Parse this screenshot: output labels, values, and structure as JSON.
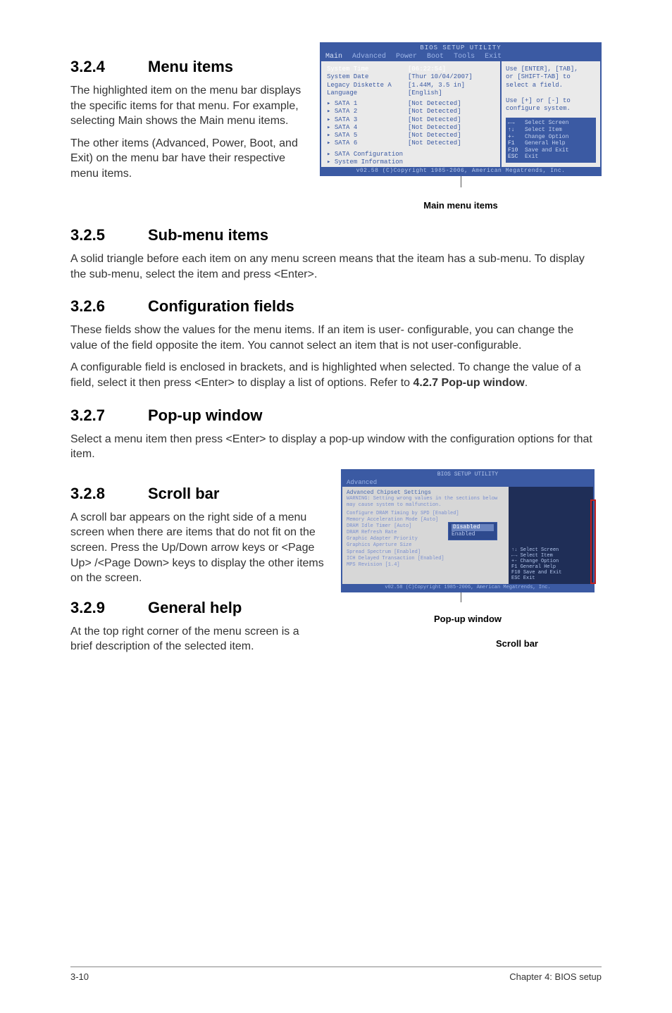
{
  "sections": {
    "s324": {
      "num": "3.2.4",
      "title": "Menu items",
      "p1": "The highlighted item on the menu bar displays the specific items for that menu. For example, selecting Main shows the Main menu items.",
      "p2": "The other items (Advanced, Power, Boot, and Exit) on the menu bar have their respective menu items."
    },
    "s325": {
      "num": "3.2.5",
      "title": "Sub-menu items",
      "p1": "A solid triangle before each item on any menu screen means that the iteam has a sub-menu. To display the sub-menu, select the item and press <Enter>."
    },
    "s326": {
      "num": "3.2.6",
      "title": "Configuration fields",
      "p1": "These fields show the values for the menu items. If an item is user- configurable, you can change the value of the field opposite the item. You cannot select an item that is not user-configurable.",
      "p2": "A configurable field is enclosed in brackets, and is highlighted when selected. To change the value of a field, select it then press <Enter> to display a list of options. Refer to ",
      "p2b": "4.2.7 Pop-up window",
      "p2c": "."
    },
    "s327": {
      "num": "3.2.7",
      "title": "Pop-up window",
      "p1": "Select a menu item then press <Enter> to display a pop-up window with the configuration options for that item."
    },
    "s328": {
      "num": "3.2.8",
      "title": "Scroll bar",
      "p1": "A scroll bar appears on the right side of a menu screen when there are items that do not fit on the screen. Press the Up/Down arrow keys or <Page Up> /<Page Down> keys to display the other items on the screen."
    },
    "s329": {
      "num": "3.2.9",
      "title": "General help",
      "p1": "At the top right corner of the menu screen is a brief description of the selected item."
    }
  },
  "bios1": {
    "title": "BIOS SETUP UTILITY",
    "menubar": [
      "Main",
      "Advanced",
      "Power",
      "Boot",
      "Tools",
      "Exit"
    ],
    "rows": [
      {
        "k": "System Time",
        "v": "[06:22:54]"
      },
      {
        "k": "System Date",
        "v": "[Thur 10/04/2007]"
      },
      {
        "k": "Legacy Diskette A",
        "v": "[1.44M, 3.5 in]"
      },
      {
        "k": "Language",
        "v": "[English]"
      }
    ],
    "sata": [
      {
        "k": "SATA 1",
        "v": "[Not Detected]"
      },
      {
        "k": "SATA 2",
        "v": "[Not Detected]"
      },
      {
        "k": "SATA 3",
        "v": "[Not Detected]"
      },
      {
        "k": "SATA 4",
        "v": "[Not Detected]"
      },
      {
        "k": "SATA 5",
        "v": "[Not Detected]"
      },
      {
        "k": "SATA 6",
        "v": "[Not Detected]"
      }
    ],
    "extra": [
      "SATA Configuration",
      "System Information"
    ],
    "help": [
      "Use [ENTER], [TAB],",
      "or [SHIFT-TAB] to",
      "select a field.",
      "",
      "Use [+] or [-] to",
      "configure system."
    ],
    "keys": [
      {
        "k": "←→",
        "t": "Select Screen"
      },
      {
        "k": "↑↓",
        "t": "Select Item"
      },
      {
        "k": "+-",
        "t": "Change Option"
      },
      {
        "k": "F1",
        "t": "General Help"
      },
      {
        "k": "F10",
        "t": "Save and Exit"
      },
      {
        "k": "ESC",
        "t": "Exit"
      }
    ],
    "bottom": "v02.58 (C)Copyright 1985-2006, American Megatrends, Inc.",
    "caption": "Main menu items"
  },
  "bios2": {
    "title": "BIOS SETUP UTILITY",
    "menubar": "Advanced",
    "hdr": "Advanced Chipset Settings",
    "warn": "WARNING: Setting wrong values in the sections below may cause system to malfunction.",
    "lines": [
      "Configure DRAM Timing by SPD    [Enabled]",
      "Memory Acceleration Mode        [Auto]",
      "DRAM Idle Timer                 [Auto]",
      "DRAM Refresh Rate               ",
      "Graphic Adapter Priority        ",
      "Graphics Aperture Size          ",
      "Spread Spectrum                 [Enabled]",
      "ICH Delayed Transaction         [Enabled]",
      "MPS Revision                    [1.4]"
    ],
    "popup": {
      "sel": "Disabled",
      "opt": "Enabled"
    },
    "rkeys": [
      "Select Screen",
      "Select Item",
      "Change Option",
      "General Help",
      "Save and Exit",
      "Exit"
    ],
    "bottom": "v02.58 (C)Copyright 1985-2006, American Megatrends, Inc.",
    "cap_popup": "Pop-up window",
    "cap_scroll": "Scroll bar"
  },
  "footer": {
    "left": "3-10",
    "right": "Chapter 4: BIOS setup"
  }
}
